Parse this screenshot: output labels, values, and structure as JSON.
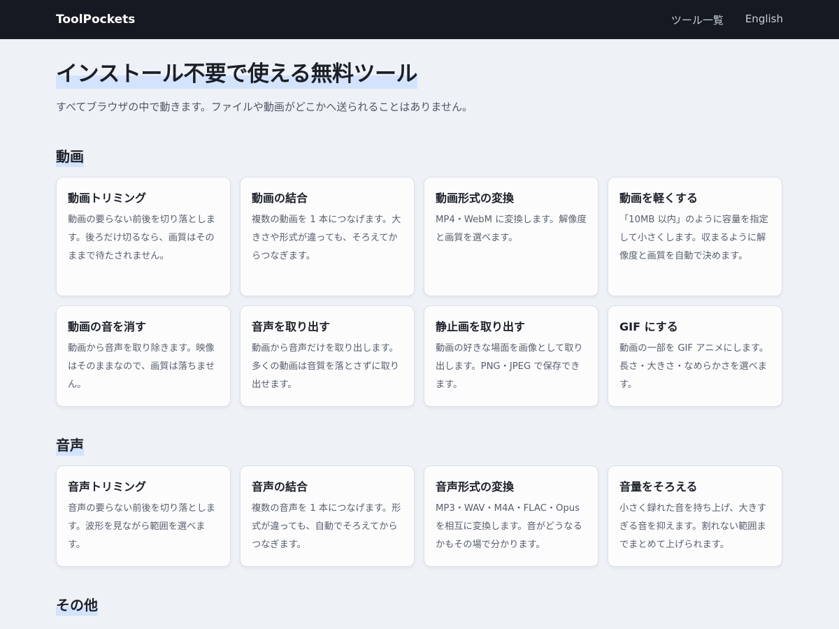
{
  "header": {
    "brand": "ToolPockets",
    "nav": [
      {
        "label": "ツール一覧"
      },
      {
        "label": "English"
      }
    ]
  },
  "hero": {
    "title": "インストール不要で使える無料ツール",
    "subtitle": "すべてブラウザの中で動きます。ファイルや動画がどこかへ送られることはありません。"
  },
  "sections": [
    {
      "title": "動画",
      "tools": [
        {
          "title": "動画トリミング",
          "desc": "動画の要らない前後を切り落とします。後ろだけ切るなら、画質はそのままで待たされません。"
        },
        {
          "title": "動画の結合",
          "desc": "複数の動画を 1 本につなげます。大きさや形式が違っても、そろえてからつなぎます。"
        },
        {
          "title": "動画形式の変換",
          "desc": "MP4・WebM に変換します。解像度と画質を選べます。"
        },
        {
          "title": "動画を軽くする",
          "desc": "「10MB 以内」のように容量を指定して小さくします。収まるように解像度と画質を自動で決めます。"
        },
        {
          "title": "動画の音を消す",
          "desc": "動画から音声を取り除きます。映像はそのままなので、画質は落ちません。"
        },
        {
          "title": "音声を取り出す",
          "desc": "動画から音声だけを取り出します。多くの動画は音質を落とさずに取り出せます。"
        },
        {
          "title": "静止画を取り出す",
          "desc": "動画の好きな場面を画像として取り出します。PNG・JPEG で保存できます。"
        },
        {
          "title": "GIF にする",
          "desc": "動画の一部を GIF アニメにします。長さ・大きさ・なめらかさを選べます。"
        }
      ]
    },
    {
      "title": "音声",
      "tools": [
        {
          "title": "音声トリミング",
          "desc": "音声の要らない前後を切り落とします。波形を見ながら範囲を選べます。"
        },
        {
          "title": "音声の結合",
          "desc": "複数の音声を 1 本につなげます。形式が違っても、自動でそろえてからつなぎます。"
        },
        {
          "title": "音声形式の変換",
          "desc": "MP3・WAV・M4A・FLAC・Opus を相互に変換します。音がどうなるかもその場で分かります。"
        },
        {
          "title": "音量をそろえる",
          "desc": "小さく録れた音を持ち上げ、大きすぎる音を抑えます。割れない範囲までまとめて上げられます。"
        }
      ]
    },
    {
      "title": "その他"
    }
  ]
}
